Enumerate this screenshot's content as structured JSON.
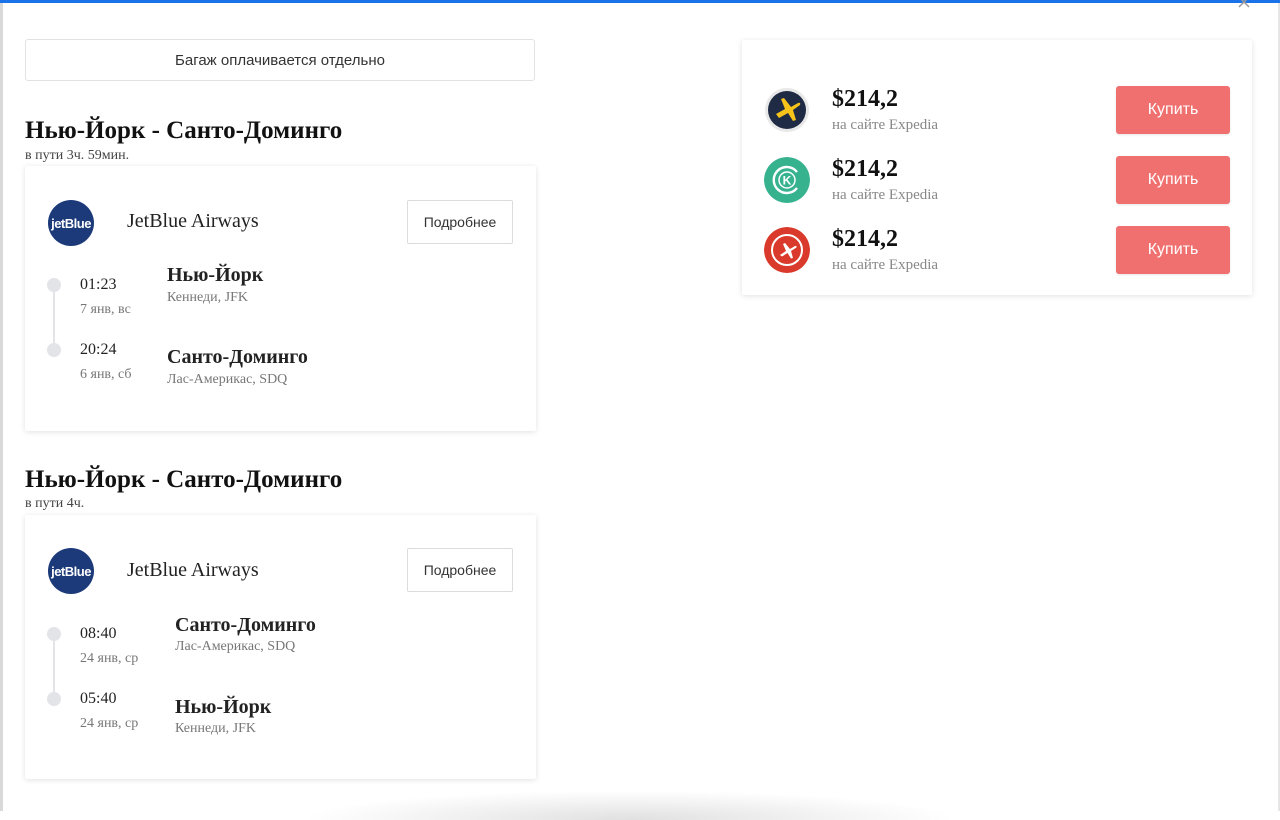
{
  "baggage_note": "Багаж оплачивается отдельно",
  "segments": [
    {
      "route": "Нью-Йорк - Санто-Доминго",
      "duration": "в пути 3ч. 59мин.",
      "airline": {
        "logo_text": "jetBlue",
        "name": "JetBlue Airways"
      },
      "details_label": "Подробнее",
      "stops": [
        {
          "time": "01:23",
          "date": "7 янв, вс",
          "city": "Нью-Йорк",
          "airport": "Кеннеди, JFK"
        },
        {
          "time": "20:24",
          "date": "6 янв, сб",
          "city": "Санто-Доминго",
          "airport": "Лас-Америкас, SDQ"
        }
      ]
    },
    {
      "route": "Нью-Йорк - Санто-Доминго",
      "duration": "в пути 4ч.",
      "airline": {
        "logo_text": "jetBlue",
        "name": "JetBlue Airways"
      },
      "details_label": "Подробнее",
      "stops": [
        {
          "time": "08:40",
          "date": "24 янв, ср",
          "city": "Санто-Доминго",
          "airport": "Лас-Америкас, SDQ"
        },
        {
          "time": "05:40",
          "date": "24 янв, ср",
          "city": "Нью-Йорк",
          "airport": "Кеннеди, JFK"
        }
      ]
    }
  ],
  "offers": [
    {
      "icon": "expedia-plane-icon",
      "icon_bg": "#1f2a44",
      "icon_fg": "#f7c31a",
      "price": "$214,2",
      "site": "на сайте Expedia",
      "buy_label": "Купить"
    },
    {
      "icon": "kayak-k-icon",
      "icon_bg": "#37b28f",
      "icon_fg": "#ffffff",
      "price": "$214,2",
      "site": "на сайте Expedia",
      "buy_label": "Купить"
    },
    {
      "icon": "red-plane-icon",
      "icon_bg": "#d93a2b",
      "icon_fg": "#ffffff",
      "price": "$214,2",
      "site": "на сайте Expedia",
      "buy_label": "Купить"
    }
  ],
  "colors": {
    "buy_button": "#f07070",
    "airline_logo_bg": "#1c3a7a",
    "top_accent": "#1a73e8"
  }
}
